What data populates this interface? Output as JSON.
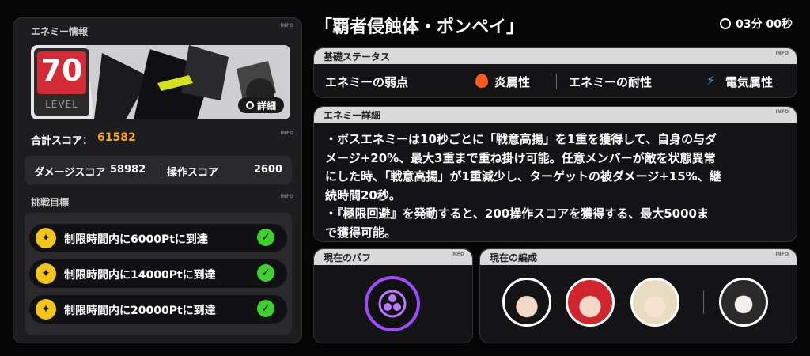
{
  "left": {
    "header_label": "エネミー情報",
    "info": "INFO",
    "level": {
      "value": "70",
      "label": "LEVEL"
    },
    "details_button": "詳細",
    "total_score_label": "合計スコア：",
    "total_score_value": "61582",
    "damage_score_label": "ダメージスコア",
    "damage_score_value": "58982",
    "ops_score_label": "操作スコア",
    "ops_score_value": "2600",
    "goals_label": "挑戦目標",
    "goals": [
      {
        "text": "制限時間内に6000Ptに到達"
      },
      {
        "text": "制限時間内に14000Ptに到達"
      },
      {
        "text": "制限時間内に20000Ptに到達"
      }
    ]
  },
  "right": {
    "enemy_name": "「覇者侵蝕体・ポンペイ」",
    "timer": "03分 00秒",
    "basic_status_label": "基礎ステータス",
    "weakness_label": "エネミーの弱点",
    "weakness_value": "炎属性",
    "resistance_label": "エネミーの耐性",
    "resistance_value": "電気属性",
    "details_label": "エネミー詳細",
    "details_text_lines": [
      "・ボスエネミーは10秒ごとに「戦意高揚」を1重を獲得して、自身の与ダ",
      "メージ+20%、最大3重まで重ね掛け可能。任意メンバーが敵を状態異常",
      "にした時、「戦意高揚」が1重減少し、ターゲットの被ダメージ+15%、継",
      "続時間20秒。",
      "・『極限回避』を発動すると、200操作スコアを獲得する、最大5000ま",
      "で獲得可能。"
    ],
    "buff_label": "現在のバフ",
    "team_label": "現在の編成"
  },
  "colors": {
    "accent": "#f7a81b",
    "level_red": "#d42a35",
    "check_green": "#3ed02e",
    "goal_yellow": "#f3c41a"
  }
}
